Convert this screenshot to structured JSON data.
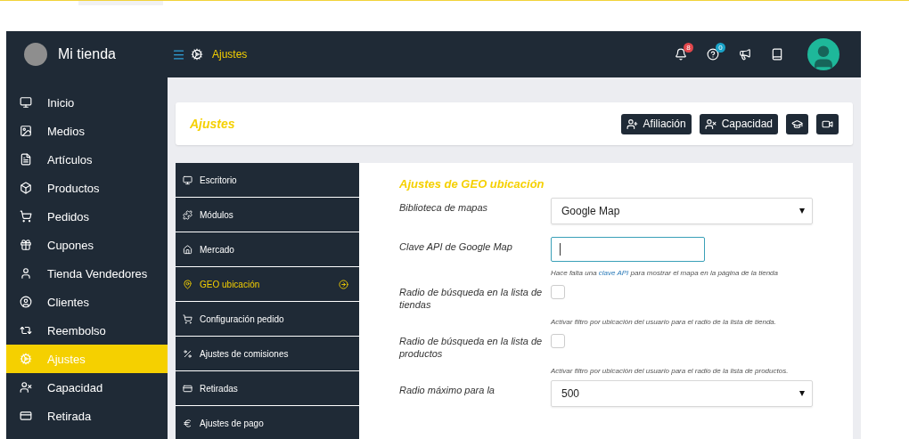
{
  "brand": {
    "name": "Mi tienda"
  },
  "topbar": {
    "breadcrumb": "Ajustes",
    "notifications_count": "8",
    "help_count": "0"
  },
  "sidebar": {
    "items": [
      {
        "label": "Inicio",
        "selected": false
      },
      {
        "label": "Medios",
        "selected": false
      },
      {
        "label": "Artículos",
        "selected": false
      },
      {
        "label": "Productos",
        "selected": false
      },
      {
        "label": "Pedidos",
        "selected": false
      },
      {
        "label": "Cupones",
        "selected": false
      },
      {
        "label": "Tienda Vendedores",
        "selected": false
      },
      {
        "label": "Clientes",
        "selected": false
      },
      {
        "label": "Reembolso",
        "selected": false
      },
      {
        "label": "Ajustes",
        "selected": true
      },
      {
        "label": "Capacidad",
        "selected": false
      },
      {
        "label": "Retirada",
        "selected": false
      }
    ]
  },
  "header": {
    "title": "Ajustes",
    "buttons": [
      {
        "label": "Afiliación"
      },
      {
        "label": "Capacidad"
      }
    ]
  },
  "settings_menu": {
    "items": [
      {
        "label": "Escritorio",
        "selected": false
      },
      {
        "label": "Módulos",
        "selected": false
      },
      {
        "label": "Mercado",
        "selected": false
      },
      {
        "label": "GEO ubicación",
        "selected": true
      },
      {
        "label": "Configuración pedido",
        "selected": false
      },
      {
        "label": "Ajustes de comisiones",
        "selected": false
      },
      {
        "label": "Retiradas",
        "selected": false
      },
      {
        "label": "Ajustes de pago",
        "selected": false
      }
    ]
  },
  "form": {
    "title": "Ajustes de GEO ubicación",
    "fields": [
      {
        "kind": "select",
        "label": "Biblioteca de mapas",
        "value": "Google Map"
      },
      {
        "kind": "text",
        "label": "Clave API de Google Map",
        "focused": true,
        "help_before": "Hace falta una",
        "help_link": "clave API",
        "help_after": "para mostrar el mapa en la página de la tienda"
      },
      {
        "kind": "checkbox",
        "label": "Radio de búsqueda en la lista de tiendas",
        "checked": false,
        "help_before": "Activar filtro por ubicación del usuario para el radio de la lista de tienda."
      },
      {
        "kind": "checkbox",
        "label": "Radio de búsqueda en la lista de productos",
        "checked": false,
        "help_before": "Activar filtro por ubicación del usuario para el radio de la lista de productos."
      },
      {
        "kind": "select",
        "label": "Radio máximo para la",
        "value": "500"
      }
    ]
  }
}
